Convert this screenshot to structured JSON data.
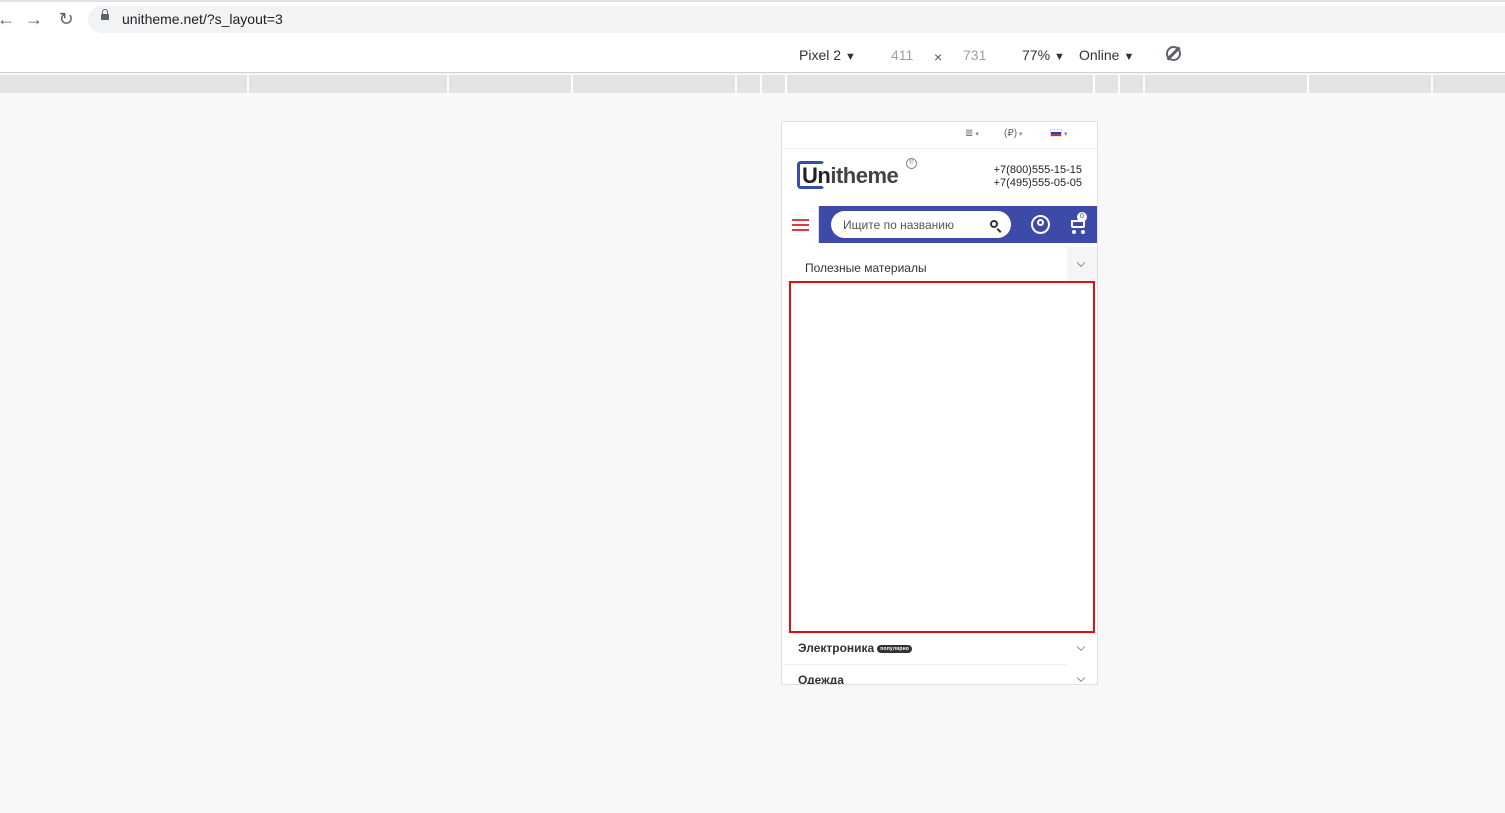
{
  "browser": {
    "back_icon": "arrow-left-icon",
    "forward_icon": "arrow-right-icon",
    "reload_icon": "reload-icon",
    "url": "unitheme.net/?s_layout=3"
  },
  "device_toolbar": {
    "device": "Pixel 2",
    "width": "411",
    "times": "×",
    "height": "731",
    "zoom": "77%",
    "network": "Online",
    "caret": "▼"
  },
  "site": {
    "topstrip": {
      "menu_icon": "≣",
      "currency": "(₽)",
      "caret": "▾",
      "language_flag": "flag-ru-icon"
    },
    "logo": {
      "u": "Un",
      "rest": "itheme",
      "reg": "®"
    },
    "phones": [
      "+7(800)555-15-15",
      "+7(495)555-05-05"
    ],
    "search": {
      "placeholder": "Ищите по названию"
    },
    "cart": {
      "count": "0"
    },
    "menu": {
      "useful": "Полезные материалы",
      "electronics": "Электроника",
      "popular_badge": "популярно",
      "clothes": "Одежда"
    },
    "accent_color": "#3e4aa8",
    "highlight_color": "#e01010"
  }
}
